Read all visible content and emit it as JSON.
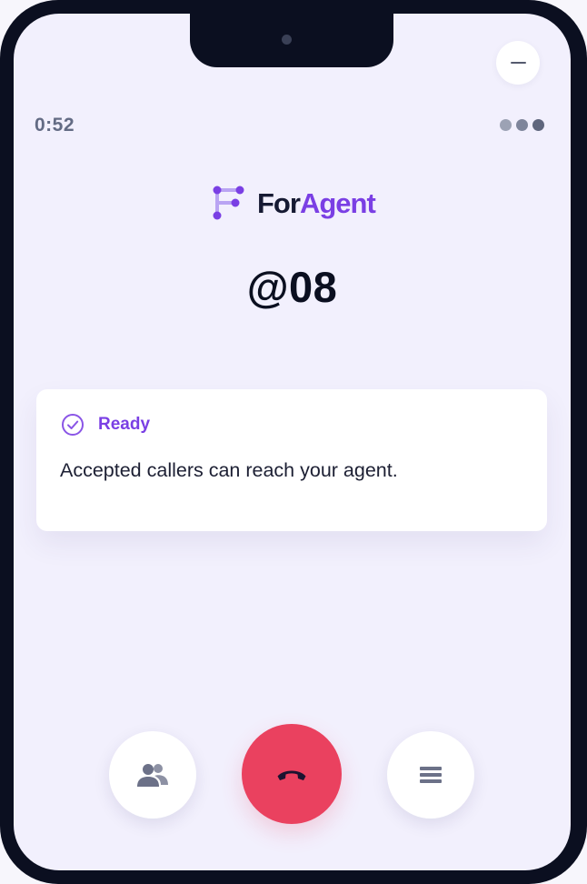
{
  "status_bar": {
    "timer": "0:52",
    "indicator_dot_colors": [
      "#9ca2b4",
      "#7e859b",
      "#5f667d"
    ],
    "notch_icon": "camera-icon",
    "minimize_icon": "minus-icon"
  },
  "brand": {
    "name_part1": "For",
    "name_part2": "Agent",
    "logo_icon": "foragent-logo-icon",
    "colors": {
      "accent": "#7a3fe4",
      "dark": "#161a33"
    }
  },
  "agent": {
    "handle": "@08"
  },
  "status": {
    "icon": "check-circle-icon",
    "title": "Ready",
    "message": "Accepted callers can reach your agent.",
    "color": "#7a3fe4"
  },
  "controls": {
    "people_icon": "people-icon",
    "end_call_icon": "phone-hangup-icon",
    "menu_icon": "menu-lines-icon",
    "end_call_color": "#ea415f"
  }
}
